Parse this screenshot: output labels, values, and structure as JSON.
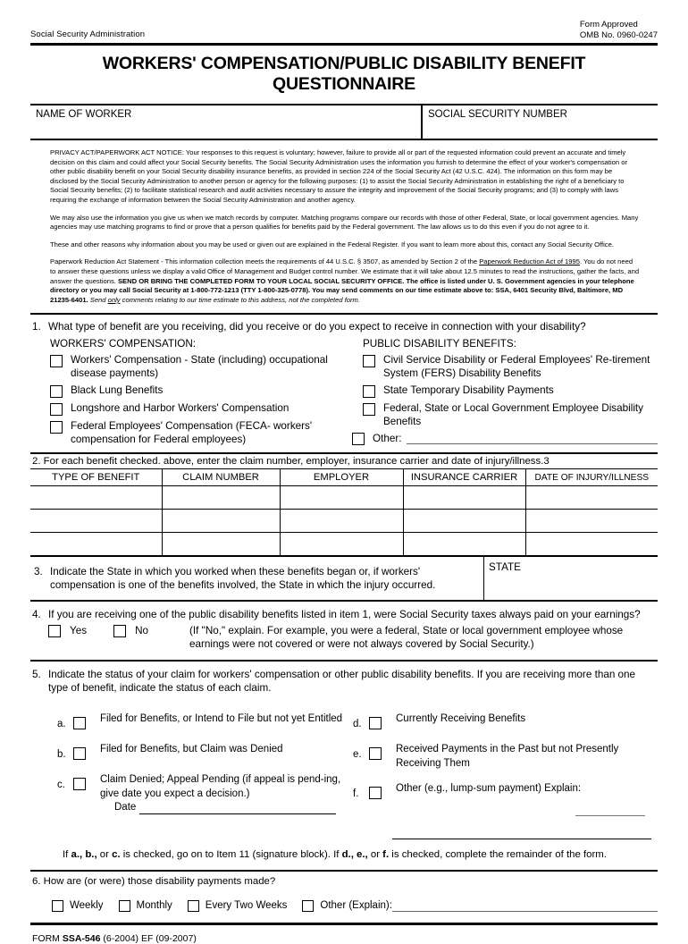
{
  "header": {
    "agency": "Social Security Administration",
    "form_approved": "Form Approved",
    "omb": "OMB No. 0960-0247",
    "title": "WORKERS' COMPENSATION/PUBLIC DISABILITY BENEFIT QUESTIONNAIRE",
    "name_of_worker": "NAME OF WORKER",
    "social_security_number": "SOCIAL SECURITY NUMBER"
  },
  "privacy": {
    "p1": "PRIVACY ACT/PAPERWORK ACT NOTICE:  Your responses to this request is voluntary; however, failure to provide all or part of the requested information could prevent an accurate and timely decision on this claim and could affect your Social Security benefits.  The Social Security Administration uses the information you furnish to determine the effect of your worker's compensation or other public disability benefit on your Social Security disability insurance benefits, as provided in section 224 of the Social Security Act (42 U.S.C. 424).  The information on this form may be disclosed by the Social Security Administration to another person or agency for the following purposes:  (1) to assist the Social Security Administration in establishing the right of a beneficiary to Social Security benefits;  (2) to facilitate statistical research and audit activities necessary to assure the integrity and improvement of the Social Security programs; and (3) to comply with laws requiring the exchange of information between the Social Security Administration and another agency.",
    "p2": "We may also use the information you give us when we match records by computer.  Matching programs compare our records with those of other Federal, State, or local government agencies.  Many agencies may use matching programs to find or prove that a person qualifies for benefits paid by the Federal government.  The law allows us to do this even if you do not agree to it.",
    "p3": "These and other reasons why information about you may be used or given out are explained in the Federal Register.  If you want to learn more about this, contact any Social Security Office.",
    "p4_a": "Paperwork Reduction Act Statement - This information collection meets the requirements of 44 U.S.C. § 3507, as amended by Section 2 of the ",
    "p4_underline": "Paperwork Reduction Act of 1995",
    "p4_b": ".  You do not need to answer these questions unless we display a valid Office of Management and Budget control number.  We estimate that it will take about 12.5 minutes to read the instructions, gather the facts, and answer the questions.  ",
    "p4_bold": "SEND OR BRING THE COMPLETED FORM TO YOUR LOCAL SOCIAL SECURITY OFFICE. The office is listed under U. S. Government agencies in your telephone directory or you may call Social Security at 1-800-772-1213 (TTY 1-800-325-0778).  You may send comments on our time estimate above to: SSA, 6401 Security Blvd, Baltimore, MD  21235-6401.  ",
    "p4_italic_send": "Send ",
    "p4_italic_only": "only",
    "p4_italic_rest": " comments relating to our time estimate to this address, not the completed form."
  },
  "item1": {
    "number": "1.",
    "question": "What type of benefit are you receiving, did you receive or do you expect to receive in connection with your disability?",
    "left_heading": "WORKERS' COMPENSATION:",
    "right_heading": "PUBLIC DISABILITY BENEFITS:",
    "left_options": [
      "Workers' Compensation - State (including) occupational disease payments)",
      "Black Lung Benefits",
      "Longshore and Harbor Workers' Compensation",
      "Federal Employees' Compensation (FECA- workers' compensation for Federal employees)"
    ],
    "right_options": [
      "Civil Service Disability or Federal Employees' Re-tirement System (FERS) Disability Benefits",
      "State Temporary Disability Payments",
      "Federal, State or Local Government Employee Disability Benefits"
    ],
    "other_label": "Other:"
  },
  "item2": {
    "label": "2.  For each benefit checked. above, enter the claim number, employer, insurance carrier and date of injury/illness.3",
    "columns": [
      "TYPE OF BENEFIT",
      "CLAIM NUMBER",
      "EMPLOYER",
      "INSURANCE CARRIER",
      "DATE OF INJURY/ILLNESS"
    ],
    "rows": [
      [
        "",
        "",
        "",
        "",
        ""
      ],
      [
        "",
        "",
        "",
        "",
        ""
      ],
      [
        "",
        "",
        "",
        "",
        ""
      ]
    ]
  },
  "item3": {
    "number": "3.",
    "question": "Indicate the State in which you worked when these benefits began or, if workers' compensation is one of the benefits involved, the State in which the injury occurred.",
    "state_label": "STATE",
    "state_value": ""
  },
  "item4": {
    "number": "4.",
    "question": "If you are receiving one of the public disability benefits listed in item 1, were Social Security taxes always paid on your earnings?",
    "yes_label": "Yes",
    "no_label": "No",
    "note": "(If \"No,\" explain. For example, you were a federal, State or local government employee whose earnings were not covered or were not always covered by Social Security.)"
  },
  "item5": {
    "number": "5.",
    "question": "Indicate the status of your claim for workers' compensation or other public disability benefits. If you are receiving more than one type of benefit, indicate the status of each claim.",
    "options": [
      {
        "letter": "a.",
        "label": "Filed for Benefits, or Intend to File but not yet Entitled"
      },
      {
        "letter": "b.",
        "label": "Filed for Benefits, but Claim was Denied"
      },
      {
        "letter": "c.",
        "label": "Claim Denied; Appeal Pending (if appeal is pend-ing, give date you expect a decision.)"
      },
      {
        "letter": "d.",
        "label": "Currently Receiving Benefits"
      },
      {
        "letter": "e.",
        "label": "Received Payments in the Past but not Presently Receiving Them"
      },
      {
        "letter": "f.",
        "label": "Other (e.g., lump-sum payment) Explain:"
      }
    ],
    "date_label": "Date",
    "date_value": "",
    "explain_value": "",
    "footnote_pre": "If ",
    "footnote_abc": "a., b.,",
    "footnote_mid": " or ",
    "footnote_c": "c.",
    "footnote_mid2": " is checked, go on to Item 11 (signature block). If ",
    "footnote_def": "d., e.,",
    "footnote_mid3": " or ",
    "footnote_f": "f.",
    "footnote_end": " is checked, complete the remainder of the form.",
    "footnote_full": "If a., b., or c. is checked, go on to Item 11 (signature block). If d., e., or f. is checked, complete the remainder of the form."
  },
  "item6": {
    "label": "6. How are (or were) those disability payments made?",
    "options": [
      "Weekly",
      "Monthly",
      "Every Two Weeks"
    ],
    "other_label": "Other (Explain):",
    "other_value": ""
  },
  "footer": {
    "form_prefix": "FORM ",
    "form_id": "SSA-546",
    "form_suffix": " (6-2004)  EF (09-2007)"
  }
}
